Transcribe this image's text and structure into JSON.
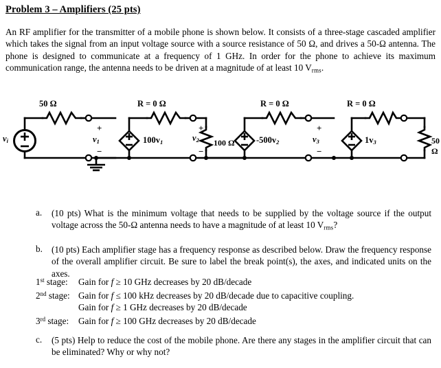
{
  "document": {
    "title": "Problem 3 – Amplifiers (25 pts)",
    "intro_part1": "An RF amplifier for the transmitter of a mobile phone is shown below.  It consists of a three-stage cascaded amplifier which takes the signal from an input voltage source with a source resistance of 50 ",
    "intro_part2": ", and drives a 50-",
    "intro_part3": " antenna.  The phone is designed to communicate at a frequency of 1 GHz.  In order for the phone to achieve its maximum communication range, the antenna needs to be driven at a magnitude of at least 10 V",
    "intro_sub": "rms",
    "intro_end": "."
  },
  "circuit": {
    "source_label": "v",
    "source_sub": "i",
    "source_plus": "+",
    "source_minus": "−",
    "r_source_label": "50 Ω",
    "node1_label": "v",
    "node1_sub": "1",
    "node1_plus": "+",
    "node1_minus": "−",
    "stage1_source_label": "100v",
    "stage1_source_sub": "1",
    "stage1_r_label": "R = 0 Ω",
    "node2_label": "v",
    "node2_sub": "2",
    "node2_plus": "+",
    "node2_minus": "−",
    "load1_label": "100 Ω",
    "stage2_source_label": "-500v",
    "stage2_source_sub": "2",
    "stage2_r_label": "R = 0 Ω",
    "node3_label": "v",
    "node3_sub": "3",
    "node3_plus": "+",
    "node3_minus": "−",
    "stage3_source_label": "1v",
    "stage3_source_sub": "3",
    "stage3_r_label": "R = 0 Ω",
    "antenna_label": "50 Ω",
    "ground_name": "ground-symbol",
    "line_color": "#000000"
  },
  "questions": {
    "a": {
      "marker": "a.",
      "text_part1": "(10 pts) What is the minimum voltage that needs to be supplied by the voltage source if the output voltage across the 50-",
      "text_part2": " antenna needs to have a magnitude of at least 10 V",
      "text_sub": "rms",
      "text_end": "?"
    },
    "b": {
      "marker": "b.",
      "text": "(10 pts) Each amplifier stage has a frequency response as described below.  Draw the frequency response of the overall amplifier circuit.  Be sure to label the break point(s), the axes, and indicated units on the axes."
    },
    "c": {
      "marker": "c.",
      "text": "(5 pts) Help to reduce the cost of the mobile phone.  Are there any stages in the amplifier circuit that can be eliminated?  Why or why not?"
    }
  },
  "stages": [
    {
      "num": "1",
      "ord": "st",
      "label_suffix": " stage:",
      "lines": [
        {
          "prefix": "Gain for ",
          "var": "f",
          "cond": " ≥ 10 GHz decreases by 20 dB/decade"
        }
      ]
    },
    {
      "num": "2",
      "ord": "nd",
      "label_suffix": " stage:",
      "lines": [
        {
          "prefix": "Gain for ",
          "var": "f",
          "cond": " ≤ 100 kHz decreases by 20 dB/decade due to capacitive coupling."
        },
        {
          "prefix": "Gain for ",
          "var": "f",
          "cond": " ≥ 1 GHz decreases by 20 dB/decade"
        }
      ]
    },
    {
      "num": "3",
      "ord": "rd",
      "label_suffix": " stage:",
      "lines": [
        {
          "prefix": "Gain for ",
          "var": "f",
          "cond": " ≥ 100 GHz decreases by 20 dB/decade"
        }
      ]
    }
  ],
  "symbols": {
    "ohm": "Ω"
  }
}
